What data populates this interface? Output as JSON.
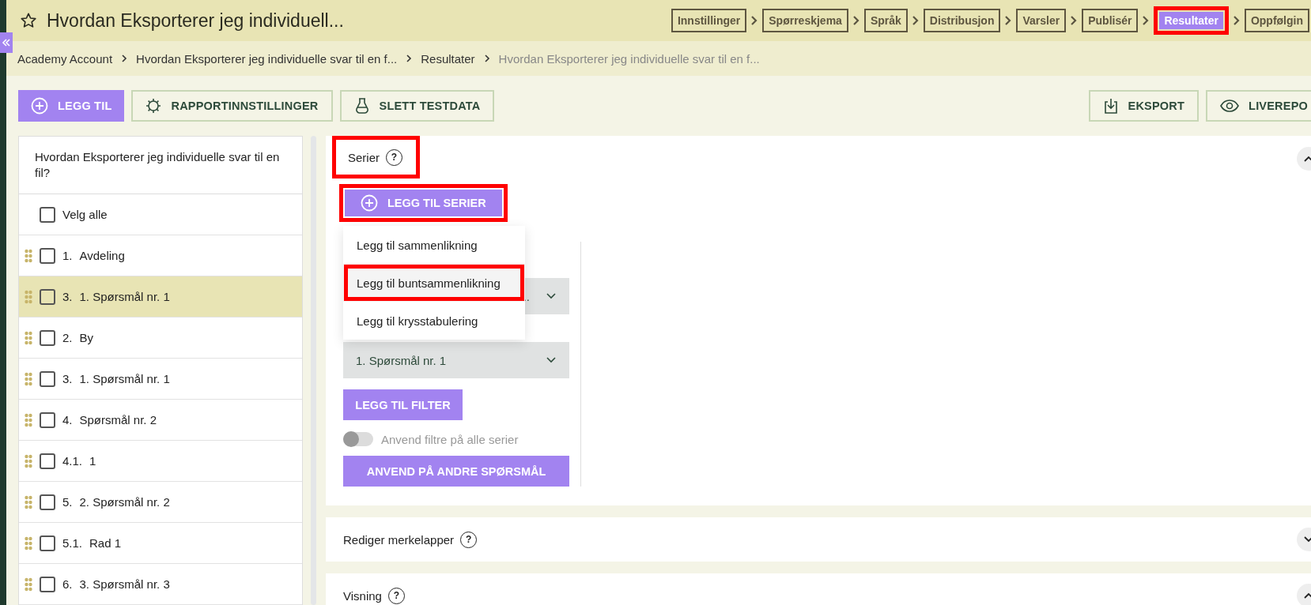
{
  "header": {
    "title": "Hvordan Eksporterer jeg individuell..."
  },
  "steps": [
    {
      "label": "Innstillinger",
      "selected": false,
      "highlighted": false
    },
    {
      "label": "Spørreskjema",
      "selected": false,
      "highlighted": false
    },
    {
      "label": "Språk",
      "selected": false,
      "highlighted": false
    },
    {
      "label": "Distribusjon",
      "selected": false,
      "highlighted": false
    },
    {
      "label": "Varsler",
      "selected": false,
      "highlighted": false
    },
    {
      "label": "Publisér",
      "selected": false,
      "highlighted": false
    },
    {
      "label": "Resultater",
      "selected": true,
      "highlighted": true
    },
    {
      "label": "Oppfølgin",
      "selected": false,
      "highlighted": false
    }
  ],
  "breadcrumb": [
    {
      "label": "Academy Account",
      "current": false
    },
    {
      "label": "Hvordan Eksporterer jeg individuelle svar til en f...",
      "current": false
    },
    {
      "label": "Resultater",
      "current": false
    },
    {
      "label": "Hvordan Eksporterer jeg individuelle svar til en f...",
      "current": true
    }
  ],
  "toolbar": {
    "left": [
      {
        "label": "LEGG TIL",
        "kind": "primary"
      },
      {
        "label": "RAPPORTINNSTILLINGER",
        "kind": "outline"
      },
      {
        "label": "SLETT TESTDATA",
        "kind": "outline"
      }
    ],
    "right": [
      {
        "label": "EKSPORT",
        "kind": "outline"
      },
      {
        "label": "LIVEREPO",
        "kind": "outline"
      }
    ]
  },
  "question_list": {
    "title": "Hvordan Eksporterer jeg individuelle svar til en fil?",
    "select_all": {
      "label": "Velg alle",
      "checked": false
    },
    "items": [
      {
        "number": "1.",
        "label": "Avdeling",
        "checked": false,
        "selected": false
      },
      {
        "number": "3.",
        "label": "1. Spørsmål nr. 1",
        "checked": false,
        "selected": true
      },
      {
        "number": "2.",
        "label": "By",
        "checked": false,
        "selected": false
      },
      {
        "number": "3.",
        "label": "1. Spørsmål nr. 1",
        "checked": false,
        "selected": false
      },
      {
        "number": "4.",
        "label": "Spørsmål nr. 2",
        "checked": false,
        "selected": false
      },
      {
        "number": "4.1.",
        "label": "1",
        "checked": false,
        "selected": false
      },
      {
        "number": "5.",
        "label": "2. Spørsmål nr. 2",
        "checked": false,
        "selected": false
      },
      {
        "number": "5.1.",
        "label": "Rad 1",
        "checked": false,
        "selected": false
      },
      {
        "number": "6.",
        "label": "3. Spørsmål nr. 3",
        "checked": false,
        "selected": false
      }
    ]
  },
  "series_panel": {
    "title": "Serier",
    "help": "?",
    "highlighted": true,
    "expanded": true,
    "add_button": {
      "label": "LEGG TIL SERIER",
      "highlighted": true
    },
    "menu": [
      {
        "label": "Legg til sammenlikning",
        "highlighted": false
      },
      {
        "label": "Legg til buntsammenlikning",
        "highlighted": true
      },
      {
        "label": "Legg til krysstabulering",
        "highlighted": false
      }
    ],
    "selects": [
      {
        "value": ".."
      },
      {
        "value": "1. Spørsmål nr. 1"
      }
    ],
    "filter_button": "LEGG TIL FILTER",
    "toggle": {
      "label": "Anvend filtre på alle serier",
      "on": false
    },
    "apply_button": "ANVEND PÅ ANDRE SPØRSMÅL"
  },
  "panels": [
    {
      "title": "Rediger merkelapper",
      "help": "?",
      "expanded": false
    },
    {
      "title": "Visning",
      "help": "?",
      "expanded": true
    }
  ]
}
